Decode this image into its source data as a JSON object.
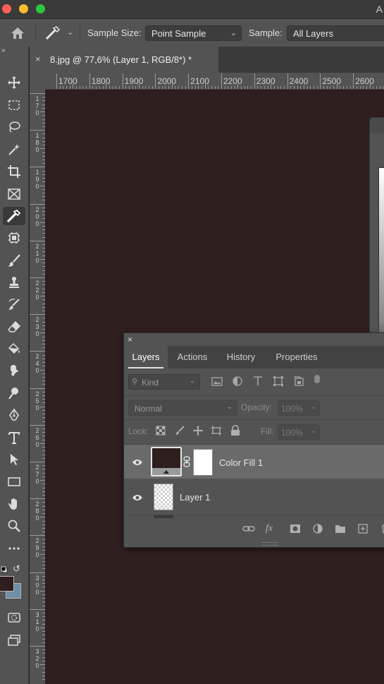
{
  "titlebar": {
    "app_letter": "A",
    "colors": {
      "close": "#fe5f57",
      "minimize": "#febc2e",
      "zoom": "#28c840"
    }
  },
  "options_bar": {
    "home_icon": "home-icon",
    "tool_icon": "eyedropper-icon",
    "sample_size_label": "Sample Size:",
    "sample_size_value": "Point Sample",
    "sample_label": "Sample:",
    "sample_value": "All Layers"
  },
  "document_tab": {
    "close": "×",
    "title": "8.jpg @ 77,6% (Layer 1, RGB/8*) *"
  },
  "ruler": {
    "horizontal": [
      "1700",
      "1800",
      "1900",
      "2000",
      "2100",
      "2200",
      "2300",
      "2400",
      "2500",
      "2600"
    ],
    "vertical": [
      "170",
      "180",
      "190",
      "200",
      "210",
      "220",
      "230",
      "240",
      "250",
      "260",
      "270",
      "280",
      "290",
      "300",
      "310",
      "320"
    ]
  },
  "toolbar": {
    "tools": [
      "move-tool",
      "marquee-tool",
      "lasso-tool",
      "magic-wand-tool",
      "crop-tool",
      "frame-tool",
      "eyedropper-tool",
      "patch-tool",
      "brush-tool",
      "stamp-tool",
      "history-brush-tool",
      "eraser-tool",
      "paint-bucket-tool",
      "smudge-tool",
      "dodge-tool",
      "pen-tool",
      "type-tool",
      "path-selection-tool",
      "rectangle-tool",
      "hand-tool",
      "zoom-tool",
      "more-tools",
      "swap-colors",
      "foreground-color",
      "background-color",
      "quick-mask",
      "screen-mode"
    ],
    "colors": {
      "foreground": "#2e1e1e",
      "background": "#6f8ea8",
      "canvas": "#2e1e1e"
    }
  },
  "layers_panel": {
    "close": "×",
    "tabs": [
      "Layers",
      "Actions",
      "History",
      "Properties"
    ],
    "active_tab": "Layers",
    "filter_placeholder": "Kind",
    "blend_mode": "Normal",
    "opacity_label": "Opacity:",
    "opacity_value": "100%",
    "lock_label": "Lock:",
    "fill_label": "Fill:",
    "fill_value": "100%",
    "layers": [
      {
        "name": "Color Fill 1",
        "visible": true,
        "selected": true
      },
      {
        "name": "Layer 1",
        "visible": true,
        "selected": false
      }
    ],
    "footer_icons": [
      "link-icon",
      "fx-icon",
      "mask-icon",
      "adjustment-icon",
      "folder-icon",
      "new-layer-icon",
      "trash-icon"
    ],
    "footer_fx": "fx"
  }
}
